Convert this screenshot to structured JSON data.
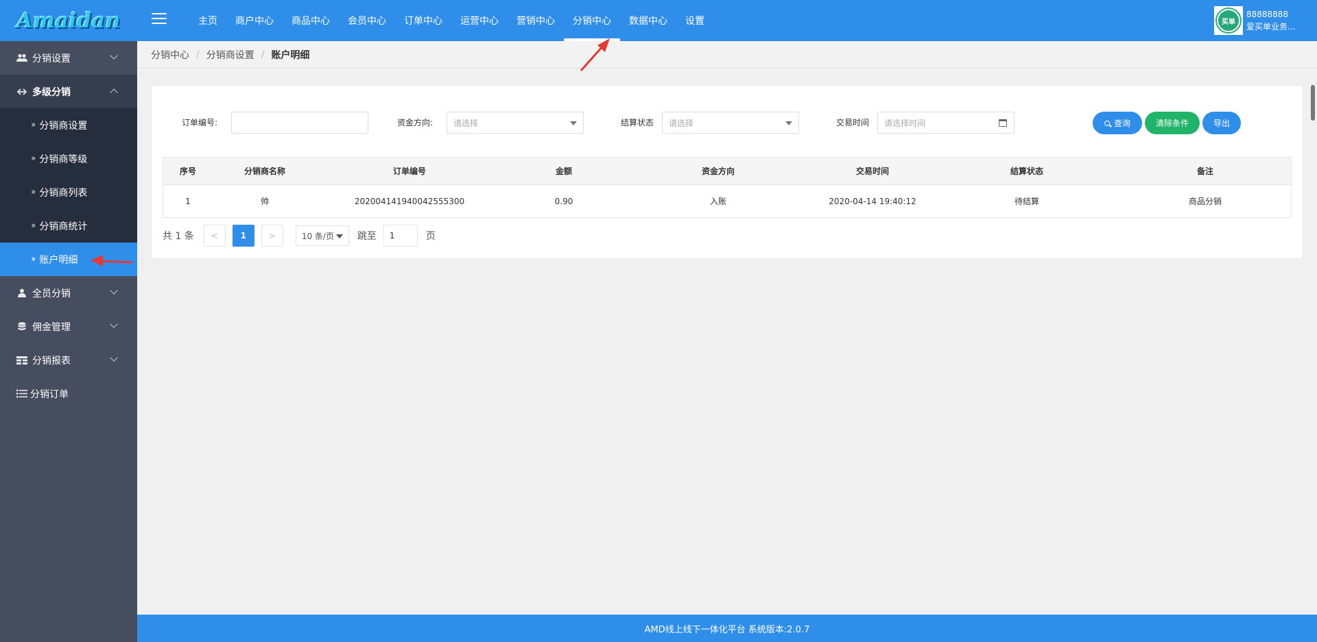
{
  "brand": {
    "logo_text": "Amaidan"
  },
  "topnav": [
    {
      "label": "主页",
      "active": false
    },
    {
      "label": "商户中心",
      "active": false
    },
    {
      "label": "商品中心",
      "active": false
    },
    {
      "label": "会员中心",
      "active": false
    },
    {
      "label": "订单中心",
      "active": false
    },
    {
      "label": "运营中心",
      "active": false
    },
    {
      "label": "营销中心",
      "active": false
    },
    {
      "label": "分销中心",
      "active": true
    },
    {
      "label": "数据中心",
      "active": false
    },
    {
      "label": "设置",
      "active": false
    }
  ],
  "user": {
    "avatar_text": "买单",
    "id": "88888888",
    "name": "爱买单业务..."
  },
  "sidebar": {
    "items": [
      {
        "label": "分销设置",
        "icon": "users-icon",
        "expanded": false
      },
      {
        "label": "多级分销",
        "icon": "link-icon",
        "expanded": true
      },
      {
        "label": "全员分销",
        "icon": "user-icon",
        "expanded": false
      },
      {
        "label": "佣金管理",
        "icon": "database-icon",
        "expanded": false
      },
      {
        "label": "分销报表",
        "icon": "table-icon",
        "expanded": false
      },
      {
        "label": "分销订单",
        "icon": "list-icon",
        "expanded": false
      }
    ],
    "subitems": [
      {
        "label": "分销商设置",
        "active": false
      },
      {
        "label": "分销商等级",
        "active": false
      },
      {
        "label": "分销商列表",
        "active": false
      },
      {
        "label": "分销商统计",
        "active": false
      },
      {
        "label": "账户明细",
        "active": true
      }
    ]
  },
  "breadcrumb": [
    "分销中心",
    "分销商设置",
    "账户明细"
  ],
  "filters": {
    "order_no": {
      "label": "订单编号:",
      "value": ""
    },
    "fund_direction": {
      "label": "资金方向:",
      "placeholder": "请选择"
    },
    "settle_status": {
      "label": "结算状态",
      "placeholder": "请选择"
    },
    "trade_time": {
      "label": "交易时间",
      "placeholder": "请选择时间"
    }
  },
  "buttons": {
    "query": "查询",
    "clear": "清除条件",
    "export": "导出"
  },
  "table": {
    "columns": [
      "序号",
      "分销商名称",
      "订单编号",
      "金额",
      "资金方向",
      "交易时间",
      "结算状态",
      "备注"
    ],
    "rows": [
      [
        "1",
        "帅",
        "202004141940042555300",
        "0.90",
        "入账",
        "2020-04-14 19:40:12",
        "待结算",
        "商品分销"
      ]
    ]
  },
  "pagination": {
    "total_text": "共 1 条",
    "prev": "<",
    "current": "1",
    "next": ">",
    "page_size": "10 条/页",
    "jump_label": "跳至",
    "jump_value": "1",
    "page_unit": "页"
  },
  "footer": {
    "text": "AMD线上线下一体化平台 系统版本:2.0.7"
  },
  "colors": {
    "primary": "#2f8eea",
    "success": "#20b36a",
    "sidebar": "#454d5e",
    "annotation_arrow": "#e53935"
  }
}
